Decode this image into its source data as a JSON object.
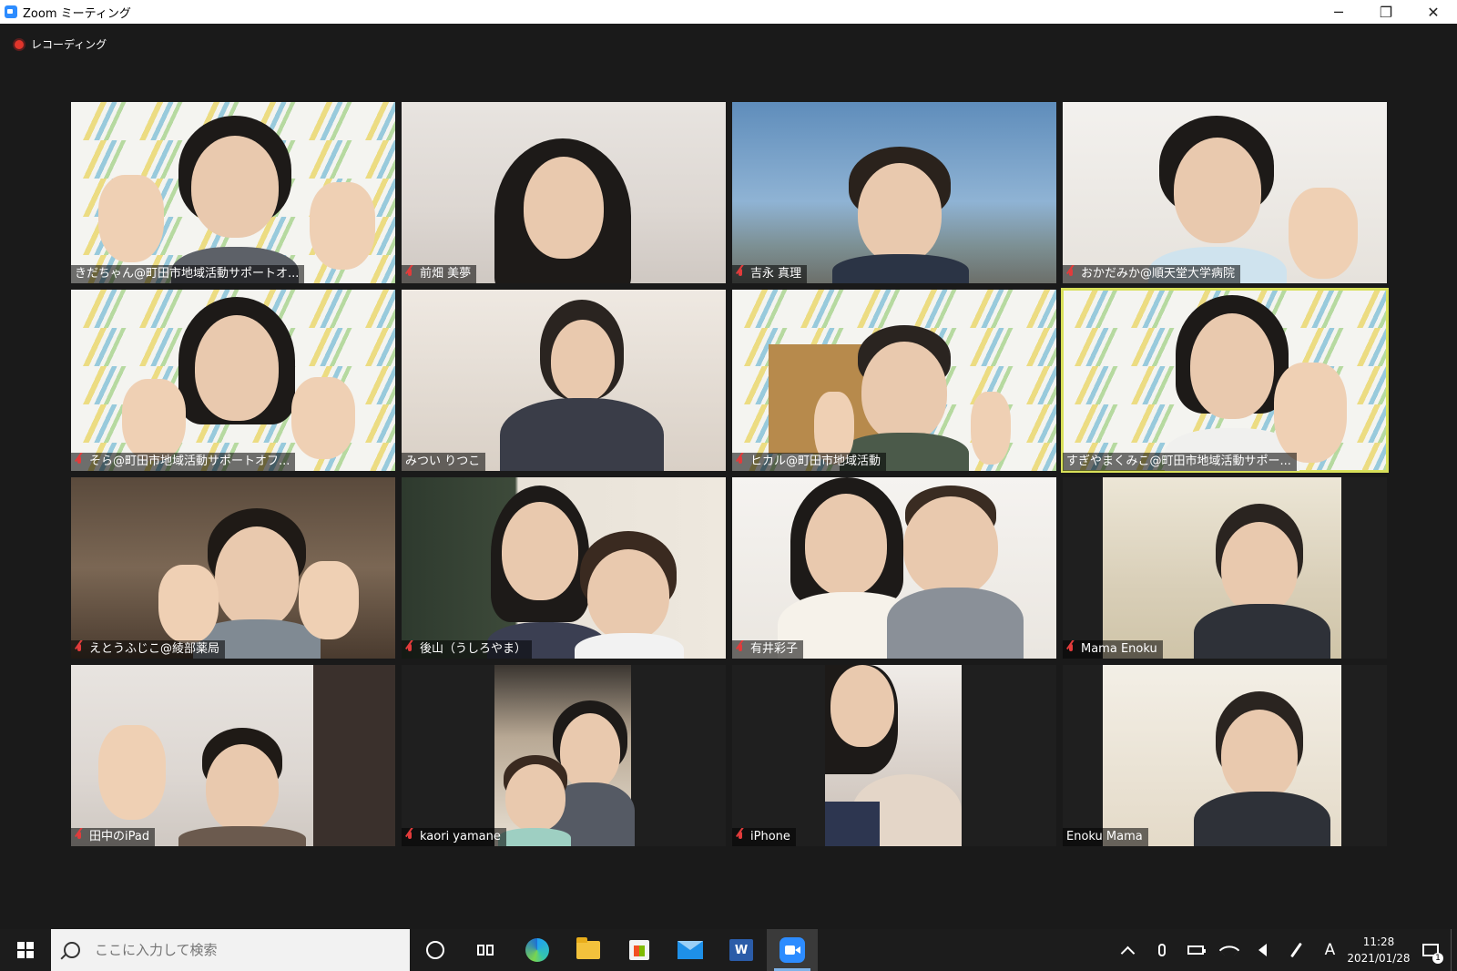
{
  "window": {
    "title": "Zoom ミーティング",
    "controls": {
      "minimize": "─",
      "restore": "❐",
      "close": "✕"
    }
  },
  "meeting": {
    "recording_label": "レコーディング",
    "participants": [
      {
        "name": "きだちゃん@町田市地域活動サポートオ...",
        "muted": false
      },
      {
        "name": "前畑 美夢",
        "muted": true
      },
      {
        "name": "吉永 真理",
        "muted": true
      },
      {
        "name": "おかだみか@順天堂大学病院",
        "muted": true
      },
      {
        "name": "そら@町田市地域活動サポートオフ...",
        "muted": true
      },
      {
        "name": "みつい りつこ",
        "muted": false
      },
      {
        "name": "ヒカル@町田市地域活動",
        "muted": true
      },
      {
        "name": "すぎやまくみこ@町田市地域活動サポー...",
        "muted": false,
        "active_speaker": true
      },
      {
        "name": "えとうふじこ@綾部薬局",
        "muted": true
      },
      {
        "name": "後山（うしろやま）",
        "muted": true
      },
      {
        "name": "有井彩子",
        "muted": true
      },
      {
        "name": "Mama Enoku",
        "muted": true
      },
      {
        "name": "田中のiPad",
        "muted": true
      },
      {
        "name": "kaori yamane",
        "muted": true
      },
      {
        "name": "iPhone",
        "muted": true
      },
      {
        "name": "Enoku Mama",
        "muted": false
      }
    ]
  },
  "taskbar": {
    "search_placeholder": "ここに入力して検索",
    "word_letter": "W",
    "ime_indicator": "A",
    "time": "11:28",
    "date": "2021/01/28",
    "notification_count": "1"
  },
  "colors": {
    "active_speaker_border": "#d8e05a",
    "zoom_blue": "#2d8cff",
    "muted_icon": "#e23b3b"
  }
}
